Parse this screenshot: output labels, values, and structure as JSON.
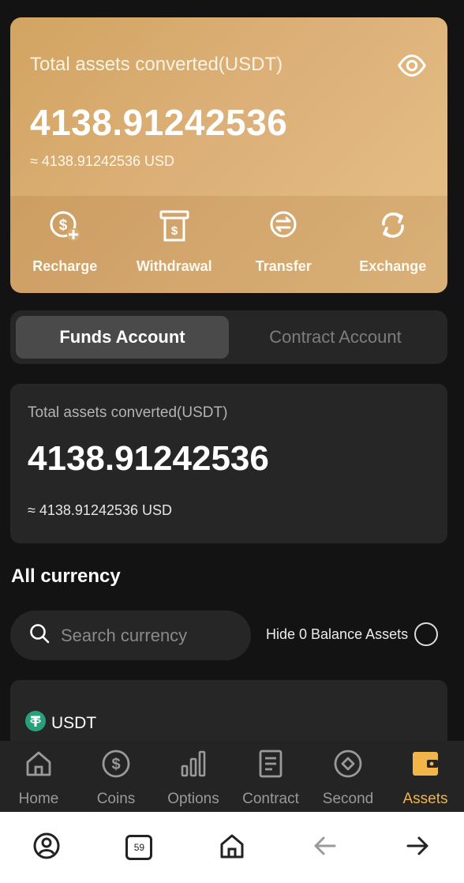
{
  "hero": {
    "label": "Total assets converted(USDT)",
    "amount": "4138.91242536",
    "usd": "≈ 4138.91242536 USD",
    "actions": [
      {
        "label": "Recharge",
        "icon": "recharge-dollar-plus-icon"
      },
      {
        "label": "Withdrawal",
        "icon": "withdrawal-atm-icon"
      },
      {
        "label": "Transfer",
        "icon": "transfer-arrows-icon"
      },
      {
        "label": "Exchange",
        "icon": "exchange-refresh-icon"
      }
    ]
  },
  "tabs": {
    "funds": "Funds Account",
    "contract": "Contract Account"
  },
  "summary": {
    "label": "Total assets converted(USDT)",
    "amount": "4138.91242536",
    "usd": "≈ 4138.91242536 USD"
  },
  "currency_section": {
    "title": "All currency",
    "search_placeholder": "Search currency",
    "hide_zero_label": "Hide 0 Balance Assets"
  },
  "currencies": [
    {
      "name": "USDT",
      "icon": "tether-coin-icon"
    }
  ],
  "bottom_nav": [
    {
      "label": "Home",
      "icon": "home-icon"
    },
    {
      "label": "Coins",
      "icon": "dollar-coin-icon"
    },
    {
      "label": "Options",
      "icon": "bar-chart-icon"
    },
    {
      "label": "Contract",
      "icon": "document-icon"
    },
    {
      "label": "Second",
      "icon": "target-circle-icon"
    },
    {
      "label": "Assets",
      "icon": "wallet-icon"
    }
  ],
  "system_bar": {
    "tab_count": "59"
  },
  "colors": {
    "accent": "#f2b54a",
    "hero_gold": "#dcb078",
    "background": "#131313",
    "card": "#262626"
  }
}
